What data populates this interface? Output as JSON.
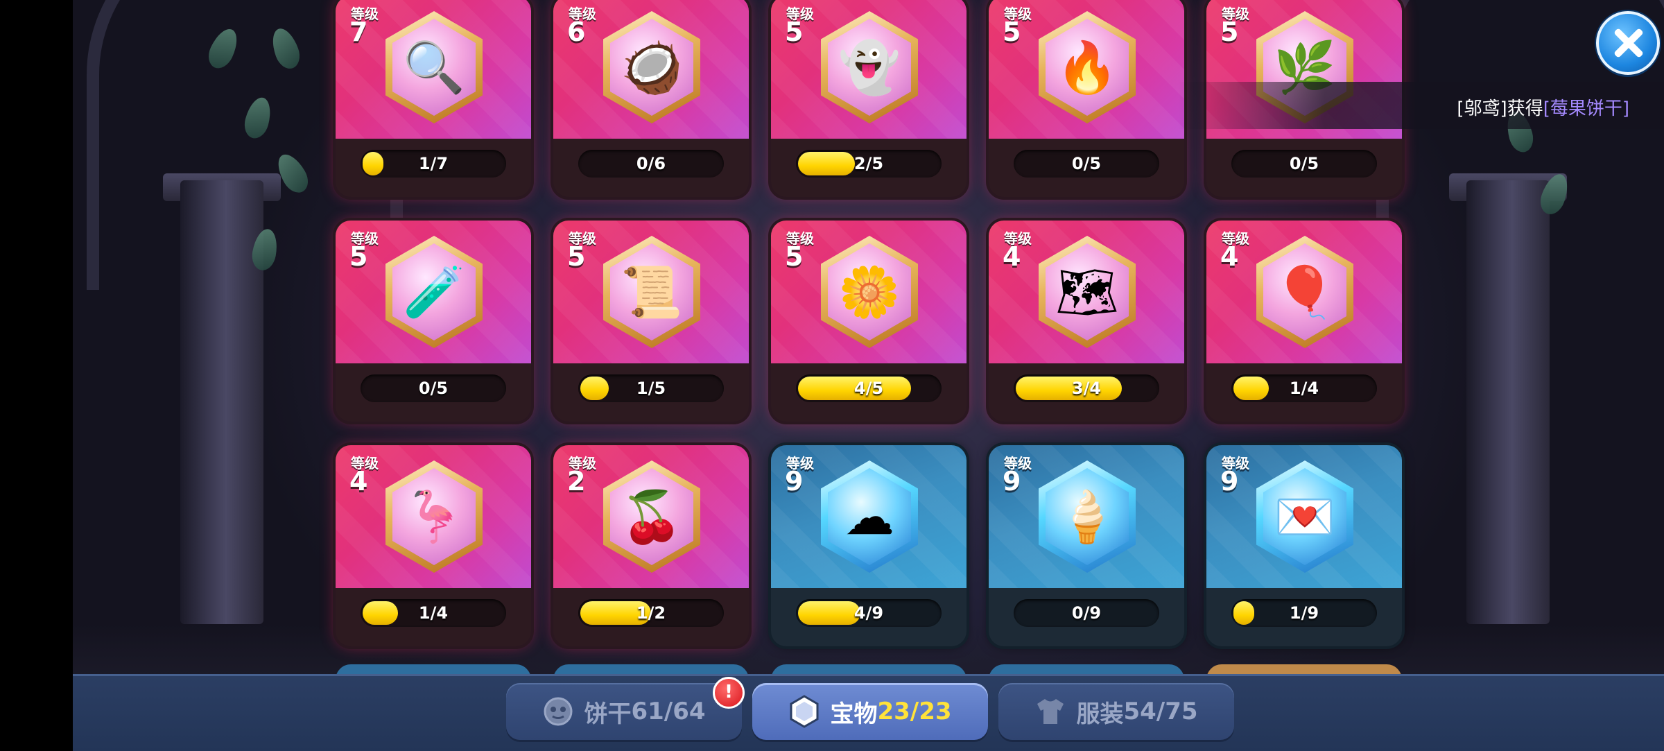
{
  "notice": {
    "prefix": "[邬鸢]获得",
    "item": "[莓果饼干]"
  },
  "level_label": "等级",
  "cards": [
    {
      "level": "7",
      "progress": "1/7",
      "fraction": 0.14,
      "theme": "pink",
      "icon": "magnifier-icon",
      "glyph": "🔍"
    },
    {
      "level": "6",
      "progress": "0/6",
      "fraction": 0.0,
      "theme": "pink",
      "icon": "coconut-icon",
      "glyph": "🥥"
    },
    {
      "level": "5",
      "progress": "2/5",
      "fraction": 0.4,
      "theme": "pink",
      "icon": "ghost-cat-icon",
      "glyph": "👻"
    },
    {
      "level": "5",
      "progress": "0/5",
      "fraction": 0.0,
      "theme": "pink",
      "icon": "flame-crown-icon",
      "glyph": "🔥"
    },
    {
      "level": "5",
      "progress": "0/5",
      "fraction": 0.0,
      "theme": "pink",
      "icon": "coral-branch-icon",
      "glyph": "🌿"
    },
    {
      "level": "5",
      "progress": "0/5",
      "fraction": 0.0,
      "theme": "pink",
      "icon": "magic-potion-icon",
      "glyph": "🧪"
    },
    {
      "level": "5",
      "progress": "1/5",
      "fraction": 0.2,
      "theme": "pink",
      "icon": "scroll-bundle-icon",
      "glyph": "📜"
    },
    {
      "level": "5",
      "progress": "4/5",
      "fraction": 0.8,
      "theme": "pink",
      "icon": "flower-wreath-icon",
      "glyph": "🌼"
    },
    {
      "level": "4",
      "progress": "3/4",
      "fraction": 0.75,
      "theme": "pink",
      "icon": "treasure-map-icon",
      "glyph": "🗺"
    },
    {
      "level": "4",
      "progress": "1/4",
      "fraction": 0.25,
      "theme": "pink",
      "icon": "cat-balloon-icon",
      "glyph": "🎈"
    },
    {
      "level": "4",
      "progress": "1/4",
      "fraction": 0.25,
      "theme": "pink",
      "icon": "flamingo-float-icon",
      "glyph": "🦩"
    },
    {
      "level": "2",
      "progress": "1/2",
      "fraction": 0.5,
      "theme": "pink",
      "icon": "berry-icon",
      "glyph": "🍒"
    },
    {
      "level": "9",
      "progress": "4/9",
      "fraction": 0.44,
      "theme": "blue",
      "icon": "cloud-spirit-icon",
      "glyph": "☁"
    },
    {
      "level": "9",
      "progress": "0/9",
      "fraction": 0.0,
      "theme": "blue",
      "icon": "ice-cream-cone-icon",
      "glyph": "🍦"
    },
    {
      "level": "9",
      "progress": "1/9",
      "fraction": 0.11,
      "theme": "blue",
      "icon": "love-letter-icon",
      "glyph": "💌"
    }
  ],
  "tabs": {
    "cookies": {
      "label": "饼干",
      "count": "61/64"
    },
    "treasures": {
      "label": "宝物",
      "count": "23/23"
    },
    "costumes": {
      "label": "服装",
      "count": "54/75"
    }
  },
  "badge": "!",
  "colors": {
    "pink_card": "#e2317c",
    "blue_card": "#3b8ec0",
    "bar_fill": "#ffd400",
    "highlight": "#a58aff"
  }
}
